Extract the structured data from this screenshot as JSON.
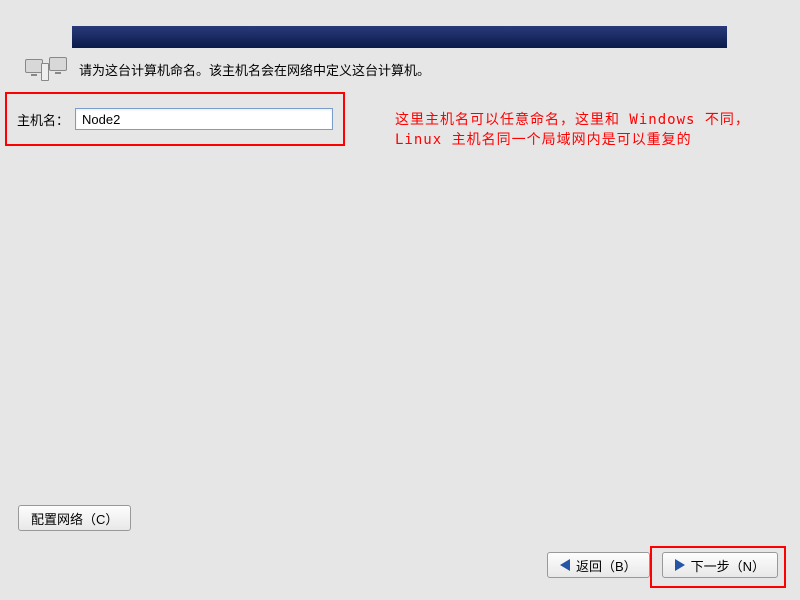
{
  "header": {},
  "instruction": {
    "text": "请为这台计算机命名。该主机名会在网络中定义这台计算机。"
  },
  "hostname": {
    "label": "主机名：",
    "value": "Node2"
  },
  "annotation": {
    "text": "这里主机名可以任意命名，这里和 Windows 不同，Linux 主机名同一个局域网内是可以重复的"
  },
  "buttons": {
    "config_network": "配置网络（C）",
    "back": "返回（B）",
    "next": "下一步（N）"
  }
}
